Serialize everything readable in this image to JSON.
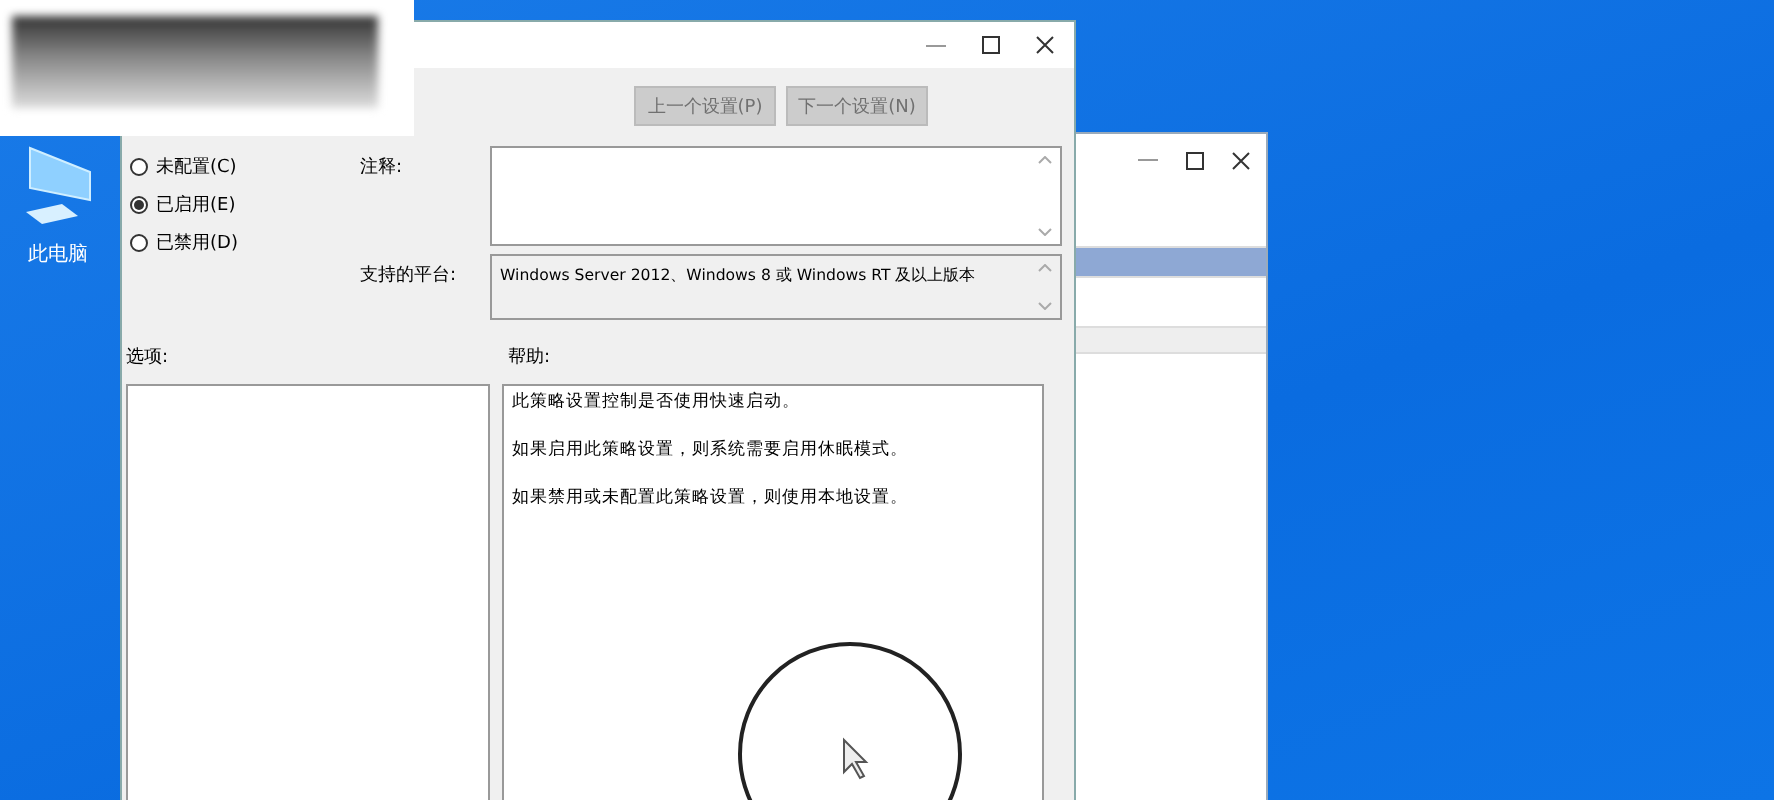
{
  "desktop_icon": {
    "label": "此电脑"
  },
  "dialog": {
    "nav_buttons": [
      {
        "label": "上一个设置(P)",
        "disabled": true
      },
      {
        "label": "下一个设置(N)",
        "disabled": true
      }
    ],
    "radios": [
      {
        "label": "未配置(C)",
        "selected": false
      },
      {
        "label": "已启用(E)",
        "selected": true
      },
      {
        "label": "已禁用(D)",
        "selected": false
      }
    ],
    "comment_label": "注释:",
    "platform_label": "支持的平台:",
    "platform_value": "Windows Server 2012、Windows 8 或 Windows RT 及以上版本",
    "options_label": "选项:",
    "help_label": "帮助:",
    "help_paragraphs": [
      "此策略设置控制是否使用快速启动。",
      "如果启用此策略设置，则系统需要启用休眠模式。",
      "如果禁用或未配置此策略设置，则使用本地设置。"
    ]
  }
}
